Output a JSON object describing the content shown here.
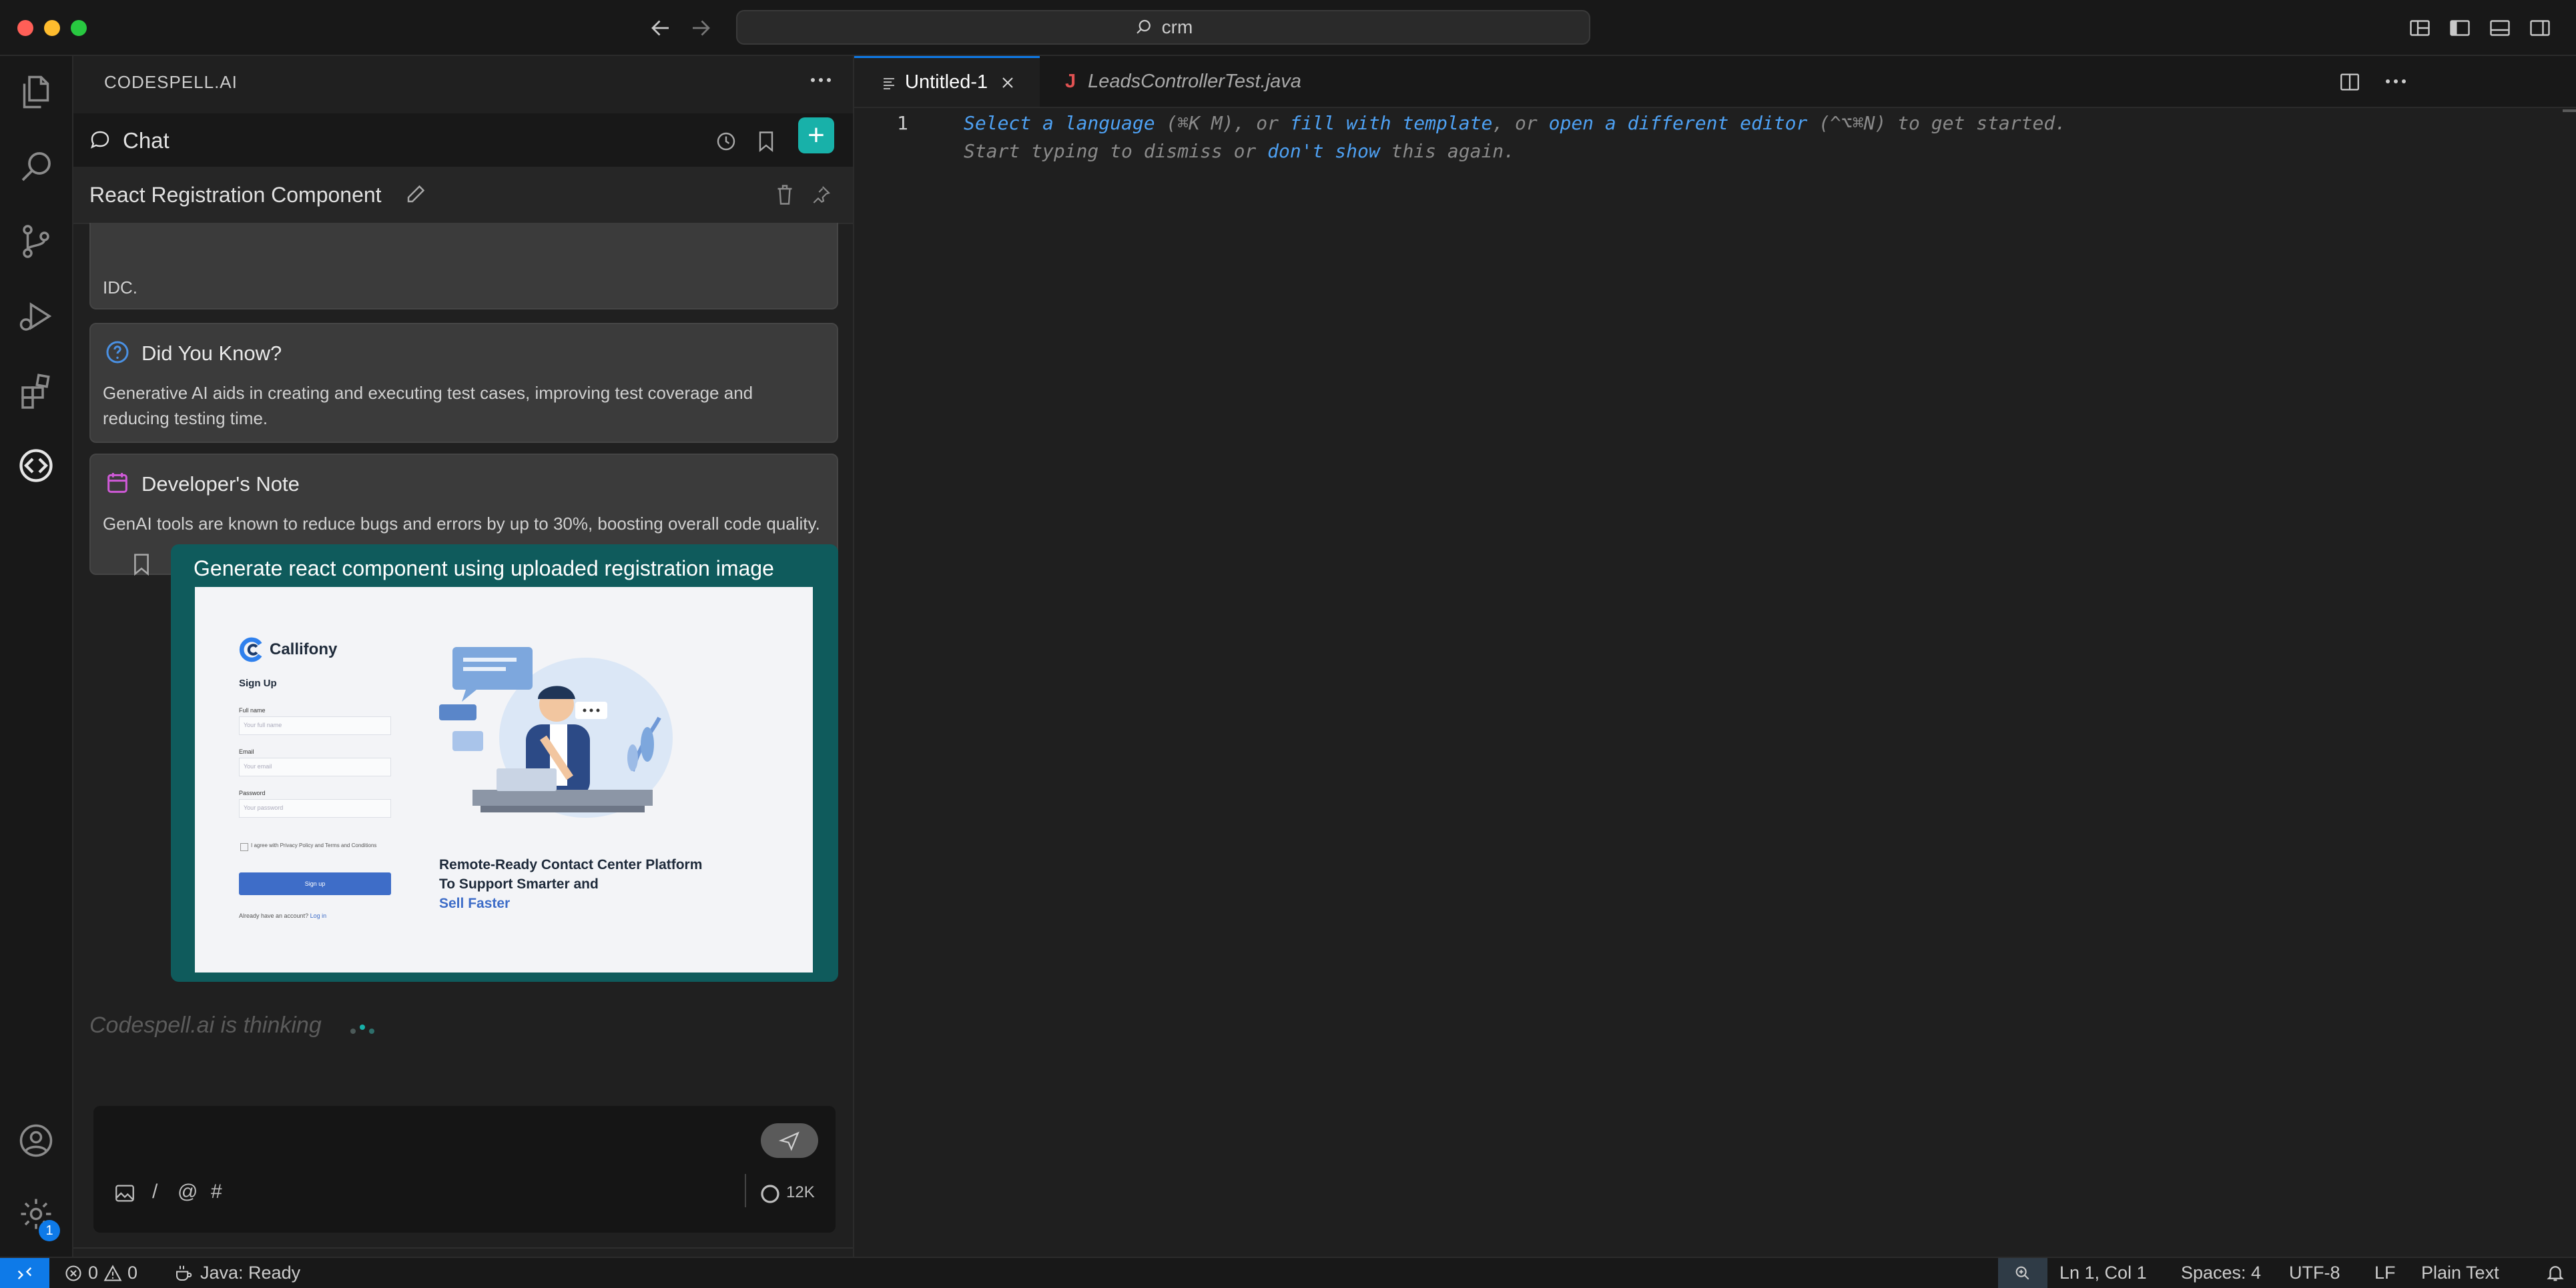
{
  "titlebar": {
    "search_text": "crm"
  },
  "sidebar": {
    "title": "CODESPELL.AI",
    "chat_label": "Chat",
    "conversation_title": "React Registration Component",
    "partial_card_text": "IDC.",
    "cards": [
      {
        "title": "Did You Know?",
        "body": "Generative AI aids in creating and executing test cases, improving test coverage and reducing testing time."
      },
      {
        "title": "Developer's Note",
        "body": "GenAI tools are known to reduce bugs and errors by up to 30%, boosting overall code quality."
      }
    ],
    "user_message": "Generate react component using uploaded registration image",
    "attachment": {
      "brand": "Callifony",
      "heading": "Sign Up",
      "full_name_label": "Full name",
      "full_name_placeholder": "Your full name",
      "email_label": "Email",
      "email_placeholder": "Your email",
      "password_label": "Password",
      "password_placeholder": "Your password",
      "terms_text": "I agree with Privacy Policy and Terms and Conditions",
      "signup_button": "Sign up",
      "login_prompt": "Already have an account?",
      "login_link": "Log in",
      "tagline": "Remote-Ready Contact Center Platform To Support Smarter and",
      "tagline_highlight": "Sell Faster"
    },
    "thinking_text": "Codespell.ai is thinking",
    "composer": {
      "slash": "/",
      "at": "@",
      "hash": "#",
      "token_count": "12K"
    },
    "settings_badge": "1"
  },
  "editor": {
    "tabs": [
      {
        "label": "Untitled-1",
        "active": true
      },
      {
        "label": "LeadsControllerTest.java",
        "active": false
      }
    ],
    "line_number": "1",
    "hint1": {
      "link1": "Select a language",
      "t1": " (⌘K M), or ",
      "link2": "fill with template",
      "t2": ", or ",
      "link3": "open a different editor",
      "t3": " (^⌥⌘N) to get started."
    },
    "hint2": {
      "t1": "Start typing to dismiss or ",
      "link1": "don't show",
      "t2": " this again."
    }
  },
  "statusbar": {
    "errors": "0",
    "warnings": "0",
    "java_status": "Java: Ready",
    "position": "Ln 1, Col 1",
    "spaces": "Spaces: 4",
    "encoding": "UTF-8",
    "eol": "LF",
    "language": "Plain Text"
  },
  "colors": {
    "accent": "#0e7ae8",
    "teal": "#18b1a9",
    "message_bg": "#0f5b5c"
  }
}
